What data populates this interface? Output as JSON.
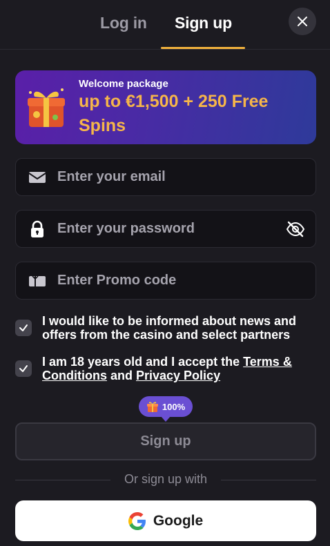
{
  "tabs": {
    "login_label": "Log in",
    "signup_label": "Sign up",
    "active": "signup"
  },
  "promo": {
    "kicker": "Welcome package",
    "headline": "up to €1,500 + 250 Free Spins"
  },
  "fields": {
    "email_placeholder": "Enter your email",
    "password_placeholder": "Enter your password",
    "promo_placeholder": "Enter Promo code"
  },
  "checkboxes": {
    "news": {
      "label": "I would like to be informed about news and offers from the casino and select partners",
      "checked": true
    },
    "age": {
      "prefix": "I am 18 years old and I accept the ",
      "terms_link": "Terms & Conditions",
      "middle": " and ",
      "privacy_link": "Privacy Policy",
      "checked": true
    }
  },
  "bonus_badge": {
    "percent": "100%"
  },
  "signup_button": "Sign up",
  "divider_text": "Or sign up with",
  "google_button": "Google",
  "colors": {
    "background": "#1c1b21",
    "accent_gold": "#f3b33d",
    "promo_headline": "#f5b54a",
    "badge_purple": "#6a4fd3"
  },
  "icons": [
    "close-icon",
    "gift-icon",
    "envelope-icon",
    "lock-icon",
    "eye-off-icon",
    "ticket-icon",
    "check-icon",
    "google-icon"
  ]
}
